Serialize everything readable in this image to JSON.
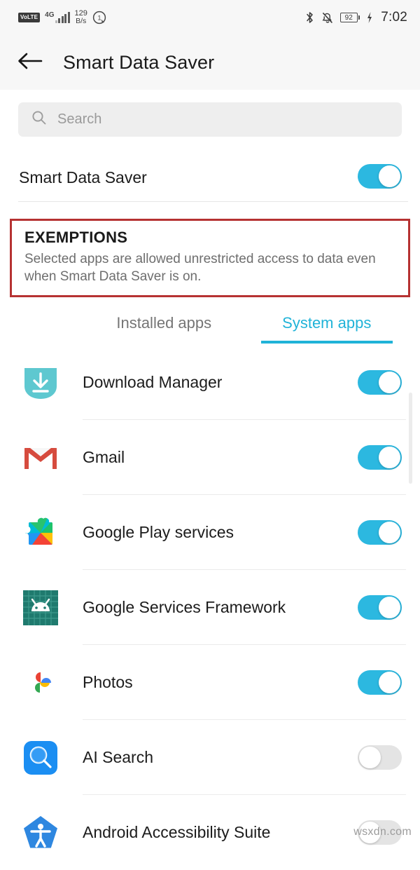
{
  "status_bar": {
    "volte_label": "VoLTE",
    "network_generation": "4G",
    "data_speed_value": "129",
    "data_speed_unit": "B/s",
    "data_saver_icon": "data-saver-icon",
    "bluetooth_icon": "bluetooth-icon",
    "silent_icon": "bell-muted-icon",
    "battery_level": "92",
    "charging_icon": "charging-bolt-icon",
    "time": "7:02"
  },
  "app_bar": {
    "back_icon": "back-arrow-icon",
    "title": "Smart Data Saver"
  },
  "search": {
    "icon": "search-icon",
    "placeholder": "Search",
    "value": ""
  },
  "master_setting": {
    "label": "Smart Data Saver",
    "enabled": true
  },
  "exemptions": {
    "title": "EXEMPTIONS",
    "description": "Selected apps are allowed unrestricted access to data even when Smart Data Saver is on.",
    "highlight_color": "#b63232"
  },
  "tabs": [
    {
      "label": "Installed apps",
      "active": false
    },
    {
      "label": "System apps",
      "active": true
    }
  ],
  "accent_color": "#20b3d8",
  "toggle_on_color": "#2cb8e0",
  "toggle_off_color": "#e4e4e4",
  "apps": [
    {
      "name": "Download Manager",
      "icon": "download-manager-icon",
      "enabled": true
    },
    {
      "name": "Gmail",
      "icon": "gmail-icon",
      "enabled": true
    },
    {
      "name": "Google Play services",
      "icon": "google-play-services-icon",
      "enabled": true
    },
    {
      "name": "Google Services Framework",
      "icon": "google-services-framework-icon",
      "enabled": true
    },
    {
      "name": "Photos",
      "icon": "google-photos-icon",
      "enabled": true
    },
    {
      "name": "AI Search",
      "icon": "ai-search-icon",
      "enabled": false
    },
    {
      "name": "Android Accessibility Suite",
      "icon": "android-accessibility-suite-icon",
      "enabled": false
    }
  ],
  "watermark": "wsxdn.com"
}
